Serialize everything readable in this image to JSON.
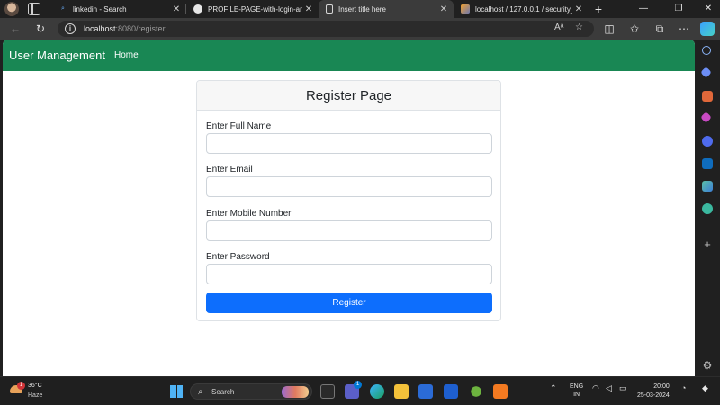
{
  "browser": {
    "tabs": [
      {
        "title": "linkedin - Search",
        "favicon": "search-icon",
        "active": false
      },
      {
        "title": "PROFILE-PAGE-with-login-and-si",
        "favicon": "github-icon",
        "active": false
      },
      {
        "title": "Insert title here",
        "favicon": "page-icon",
        "active": true
      },
      {
        "title": "localhost / 127.0.0.1 / security_d",
        "favicon": "phpmyadmin-icon",
        "active": false
      }
    ],
    "new_tab": "+",
    "url_host": "localhost",
    "url_rest": ":8080/register"
  },
  "navbar": {
    "brand": "User Management",
    "links": [
      "Home"
    ],
    "color": "#198754"
  },
  "form": {
    "header": "Register Page",
    "fields": [
      {
        "label": "Enter Full Name",
        "value": "",
        "type": "text"
      },
      {
        "label": "Enter Email",
        "value": "",
        "type": "email"
      },
      {
        "label": "Enter Mobile Number",
        "value": "",
        "type": "text"
      },
      {
        "label": "Enter Password",
        "value": "",
        "type": "password"
      }
    ],
    "submit": "Register",
    "submit_color": "#0d6efd"
  },
  "taskbar": {
    "weather_temp": "36°C",
    "weather_desc": "Haze",
    "weather_badge": "1",
    "search_placeholder": "Search",
    "app_badge": "1",
    "lang_line1": "ENG",
    "lang_line2": "IN",
    "time": "20:00",
    "date": "25-03-2024"
  }
}
